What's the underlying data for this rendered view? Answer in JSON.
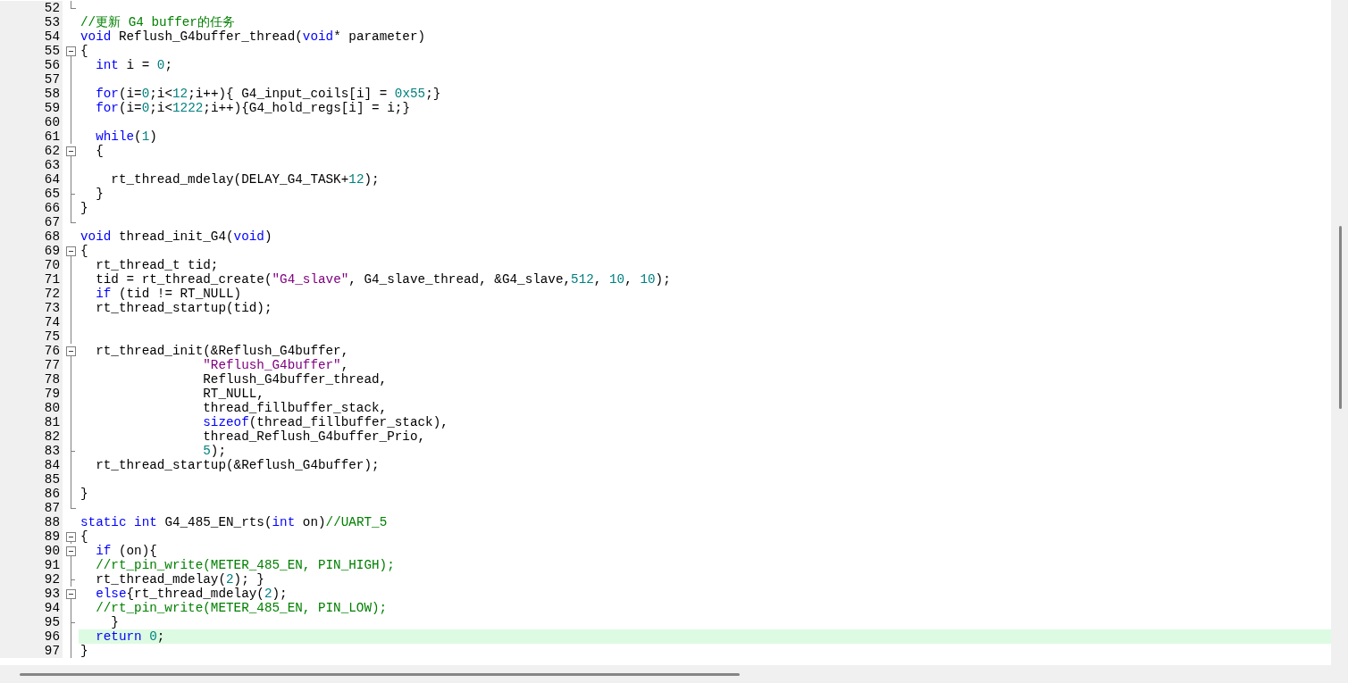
{
  "editor": {
    "lines": [
      {
        "number": "52",
        "kind": "end",
        "highlighted": false
      },
      {
        "number": "53",
        "kind": "none",
        "highlighted": false,
        "tokens": [
          {
            "kind": "comment",
            "text": "//更新 G4 buffer的任务"
          }
        ]
      },
      {
        "number": "54",
        "kind": "none",
        "highlighted": false,
        "tokens": [
          {
            "kind": "keyword",
            "text": "void"
          },
          {
            "kind": "plain",
            "text": " Reflush_G4buffer_thread("
          },
          {
            "kind": "keyword",
            "text": "void"
          },
          {
            "kind": "plain",
            "text": "* parameter)"
          }
        ]
      },
      {
        "number": "55",
        "kind": "box",
        "highlighted": false,
        "tokens": [
          {
            "kind": "plain",
            "text": "{"
          }
        ]
      },
      {
        "number": "56",
        "kind": "line",
        "highlighted": false,
        "tokens": [
          {
            "kind": "keyword",
            "text": "  int"
          },
          {
            "kind": "plain",
            "text": " i = "
          },
          {
            "kind": "number",
            "text": "0"
          },
          {
            "kind": "plain",
            "text": ";"
          }
        ]
      },
      {
        "number": "57",
        "kind": "line",
        "highlighted": false
      },
      {
        "number": "58",
        "kind": "line",
        "highlighted": false,
        "tokens": [
          {
            "kind": "keyword",
            "text": "  for"
          },
          {
            "kind": "plain",
            "text": "(i="
          },
          {
            "kind": "number",
            "text": "0"
          },
          {
            "kind": "plain",
            "text": ";i<"
          },
          {
            "kind": "number",
            "text": "12"
          },
          {
            "kind": "plain",
            "text": ";i++){ G4_input_coils[i] = "
          },
          {
            "kind": "number",
            "text": "0x55"
          },
          {
            "kind": "plain",
            "text": ";}"
          }
        ]
      },
      {
        "number": "59",
        "kind": "line",
        "highlighted": false,
        "tokens": [
          {
            "kind": "keyword",
            "text": "  for"
          },
          {
            "kind": "plain",
            "text": "(i="
          },
          {
            "kind": "number",
            "text": "0"
          },
          {
            "kind": "plain",
            "text": ";i<"
          },
          {
            "kind": "number",
            "text": "1222"
          },
          {
            "kind": "plain",
            "text": ";i++){G4_hold_regs[i] = i;}"
          }
        ]
      },
      {
        "number": "60",
        "kind": "line",
        "highlighted": false
      },
      {
        "number": "61",
        "kind": "line",
        "highlighted": false,
        "tokens": [
          {
            "kind": "keyword",
            "text": "  while"
          },
          {
            "kind": "plain",
            "text": "("
          },
          {
            "kind": "number",
            "text": "1"
          },
          {
            "kind": "plain",
            "text": ")"
          }
        ]
      },
      {
        "number": "62",
        "kind": "box",
        "highlighted": false,
        "tokens": [
          {
            "kind": "plain",
            "text": "  {"
          }
        ]
      },
      {
        "number": "63",
        "kind": "line",
        "highlighted": false
      },
      {
        "number": "64",
        "kind": "line",
        "highlighted": false,
        "tokens": [
          {
            "kind": "plain",
            "text": "    rt_thread_mdelay(DELAY_G4_TASK+"
          },
          {
            "kind": "number",
            "text": "12"
          },
          {
            "kind": "plain",
            "text": ");"
          }
        ]
      },
      {
        "number": "65",
        "kind": "tick",
        "highlighted": false,
        "tokens": [
          {
            "kind": "plain",
            "text": "  }"
          }
        ]
      },
      {
        "number": "66",
        "kind": "line",
        "highlighted": false,
        "tokens": [
          {
            "kind": "plain",
            "text": "}"
          }
        ]
      },
      {
        "number": "67",
        "kind": "end",
        "highlighted": false
      },
      {
        "number": "68",
        "kind": "none",
        "highlighted": false,
        "tokens": [
          {
            "kind": "keyword",
            "text": "void"
          },
          {
            "kind": "plain",
            "text": " thread_init_G4("
          },
          {
            "kind": "keyword",
            "text": "void"
          },
          {
            "kind": "plain",
            "text": ")"
          }
        ]
      },
      {
        "number": "69",
        "kind": "box",
        "highlighted": false,
        "tokens": [
          {
            "kind": "plain",
            "text": "{"
          }
        ]
      },
      {
        "number": "70",
        "kind": "line",
        "highlighted": false,
        "tokens": [
          {
            "kind": "plain",
            "text": "  rt_thread_t tid;"
          }
        ]
      },
      {
        "number": "71",
        "kind": "line",
        "highlighted": false,
        "tokens": [
          {
            "kind": "plain",
            "text": "  tid = rt_thread_create("
          },
          {
            "kind": "string",
            "text": "\"G4_slave\""
          },
          {
            "kind": "plain",
            "text": ", G4_slave_thread, &G4_slave,"
          },
          {
            "kind": "number",
            "text": "512"
          },
          {
            "kind": "plain",
            "text": ", "
          },
          {
            "kind": "number",
            "text": "10"
          },
          {
            "kind": "plain",
            "text": ", "
          },
          {
            "kind": "number",
            "text": "10"
          },
          {
            "kind": "plain",
            "text": ");"
          }
        ]
      },
      {
        "number": "72",
        "kind": "line",
        "highlighted": false,
        "tokens": [
          {
            "kind": "keyword",
            "text": "  if"
          },
          {
            "kind": "plain",
            "text": " (tid != RT_NULL)"
          }
        ]
      },
      {
        "number": "73",
        "kind": "line",
        "highlighted": false,
        "tokens": [
          {
            "kind": "plain",
            "text": "  rt_thread_startup(tid);"
          }
        ]
      },
      {
        "number": "74",
        "kind": "line",
        "highlighted": false
      },
      {
        "number": "75",
        "kind": "line",
        "highlighted": false
      },
      {
        "number": "76",
        "kind": "box",
        "highlighted": false,
        "tokens": [
          {
            "kind": "plain",
            "text": "  rt_thread_init(&Reflush_G4buffer,"
          }
        ]
      },
      {
        "number": "77",
        "kind": "line",
        "highlighted": false,
        "tokens": [
          {
            "kind": "string",
            "text": "                \"Reflush_G4buffer\""
          },
          {
            "kind": "plain",
            "text": ","
          }
        ]
      },
      {
        "number": "78",
        "kind": "line",
        "highlighted": false,
        "tokens": [
          {
            "kind": "plain",
            "text": "                Reflush_G4buffer_thread,"
          }
        ]
      },
      {
        "number": "79",
        "kind": "line",
        "highlighted": false,
        "tokens": [
          {
            "kind": "plain",
            "text": "                RT_NULL,"
          }
        ]
      },
      {
        "number": "80",
        "kind": "line",
        "highlighted": false,
        "tokens": [
          {
            "kind": "plain",
            "text": "                thread_fillbuffer_stack,"
          }
        ]
      },
      {
        "number": "81",
        "kind": "line",
        "highlighted": false,
        "tokens": [
          {
            "kind": "keyword",
            "text": "                sizeof"
          },
          {
            "kind": "plain",
            "text": "(thread_fillbuffer_stack),"
          }
        ]
      },
      {
        "number": "82",
        "kind": "line",
        "highlighted": false,
        "tokens": [
          {
            "kind": "plain",
            "text": "                thread_Reflush_G4buffer_Prio,"
          }
        ]
      },
      {
        "number": "83",
        "kind": "tick",
        "highlighted": false,
        "tokens": [
          {
            "kind": "number",
            "text": "                5"
          },
          {
            "kind": "plain",
            "text": ");"
          }
        ]
      },
      {
        "number": "84",
        "kind": "line",
        "highlighted": false,
        "tokens": [
          {
            "kind": "plain",
            "text": "  rt_thread_startup(&Reflush_G4buffer);"
          }
        ]
      },
      {
        "number": "85",
        "kind": "line",
        "highlighted": false
      },
      {
        "number": "86",
        "kind": "line",
        "highlighted": false,
        "tokens": [
          {
            "kind": "plain",
            "text": "}"
          }
        ]
      },
      {
        "number": "87",
        "kind": "end",
        "highlighted": false
      },
      {
        "number": "88",
        "kind": "none",
        "highlighted": false,
        "tokens": [
          {
            "kind": "keyword",
            "text": "static int"
          },
          {
            "kind": "plain",
            "text": " G4_485_EN_rts("
          },
          {
            "kind": "keyword",
            "text": "int"
          },
          {
            "kind": "plain",
            "text": " on)"
          },
          {
            "kind": "comment",
            "text": "//UART_5"
          }
        ]
      },
      {
        "number": "89",
        "kind": "box",
        "highlighted": false,
        "tokens": [
          {
            "kind": "plain",
            "text": "{"
          }
        ]
      },
      {
        "number": "90",
        "kind": "box",
        "highlighted": false,
        "tokens": [
          {
            "kind": "keyword",
            "text": "  if"
          },
          {
            "kind": "plain",
            "text": " (on){"
          }
        ]
      },
      {
        "number": "91",
        "kind": "line",
        "highlighted": false,
        "tokens": [
          {
            "kind": "comment",
            "text": "  //rt_pin_write(METER_485_EN, PIN_HIGH);"
          }
        ]
      },
      {
        "number": "92",
        "kind": "tick",
        "highlighted": false,
        "tokens": [
          {
            "kind": "plain",
            "text": "  rt_thread_mdelay("
          },
          {
            "kind": "number",
            "text": "2"
          },
          {
            "kind": "plain",
            "text": "); }"
          }
        ]
      },
      {
        "number": "93",
        "kind": "box",
        "highlighted": false,
        "tokens": [
          {
            "kind": "keyword",
            "text": "  else"
          },
          {
            "kind": "plain",
            "text": "{rt_thread_mdelay("
          },
          {
            "kind": "number",
            "text": "2"
          },
          {
            "kind": "plain",
            "text": ");"
          }
        ]
      },
      {
        "number": "94",
        "kind": "line",
        "highlighted": false,
        "tokens": [
          {
            "kind": "comment",
            "text": "  //rt_pin_write(METER_485_EN, PIN_LOW);"
          }
        ]
      },
      {
        "number": "95",
        "kind": "tick",
        "highlighted": false,
        "tokens": [
          {
            "kind": "plain",
            "text": "    }"
          }
        ]
      },
      {
        "number": "96",
        "kind": "line",
        "highlighted": true,
        "tokens": [
          {
            "kind": "keyword",
            "text": "  return "
          },
          {
            "kind": "number",
            "text": "0"
          },
          {
            "kind": "plain",
            "text": ";"
          }
        ]
      },
      {
        "number": "97",
        "kind": "line",
        "highlighted": false,
        "tokens": [
          {
            "kind": "plain",
            "text": "}"
          }
        ]
      }
    ]
  }
}
